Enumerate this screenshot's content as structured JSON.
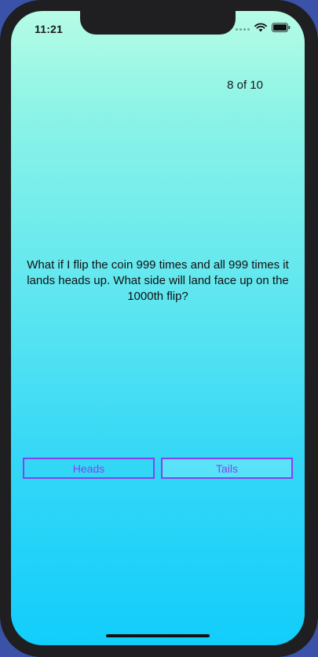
{
  "status_bar": {
    "time": "11:21"
  },
  "quiz": {
    "progress_text": "8 of 10",
    "question": "What if I flip the coin 999 times and all 999 times it lands heads up. What side will land face up on the 1000th flip?",
    "answers": [
      {
        "label": "Heads"
      },
      {
        "label": "Tails"
      }
    ]
  },
  "colors": {
    "accent": "#8a3ff2",
    "gradient_top": "#b6fce6",
    "gradient_bottom": "#12cdfb",
    "bezel": "#1f1f21"
  }
}
